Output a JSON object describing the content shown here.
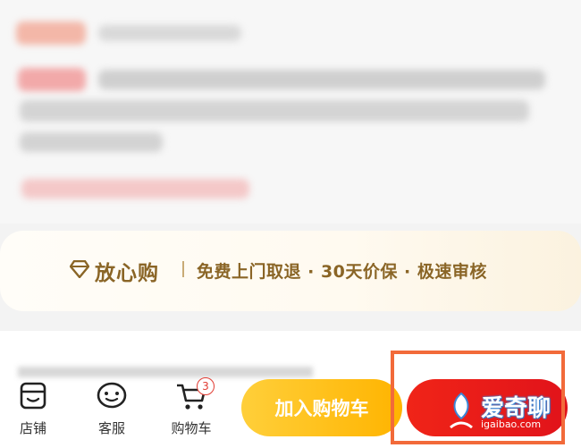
{
  "assurance": {
    "title": "放心购",
    "text": "免费上门取退 · 30天价保 · 极速审核",
    "color": "#8a6526"
  },
  "bottom_nav": {
    "store_label": "店铺",
    "service_label": "客服",
    "cart_label": "购物车",
    "cart_badge": "3"
  },
  "actions": {
    "add_to_cart_label": "加入购物车",
    "add_to_cart_color": "#ffc12a",
    "buy_color": "#ee1e19",
    "highlight_color": "#f26a3a"
  },
  "watermark": {
    "brand": "爱奇聊",
    "domain": "igaibao.com"
  }
}
